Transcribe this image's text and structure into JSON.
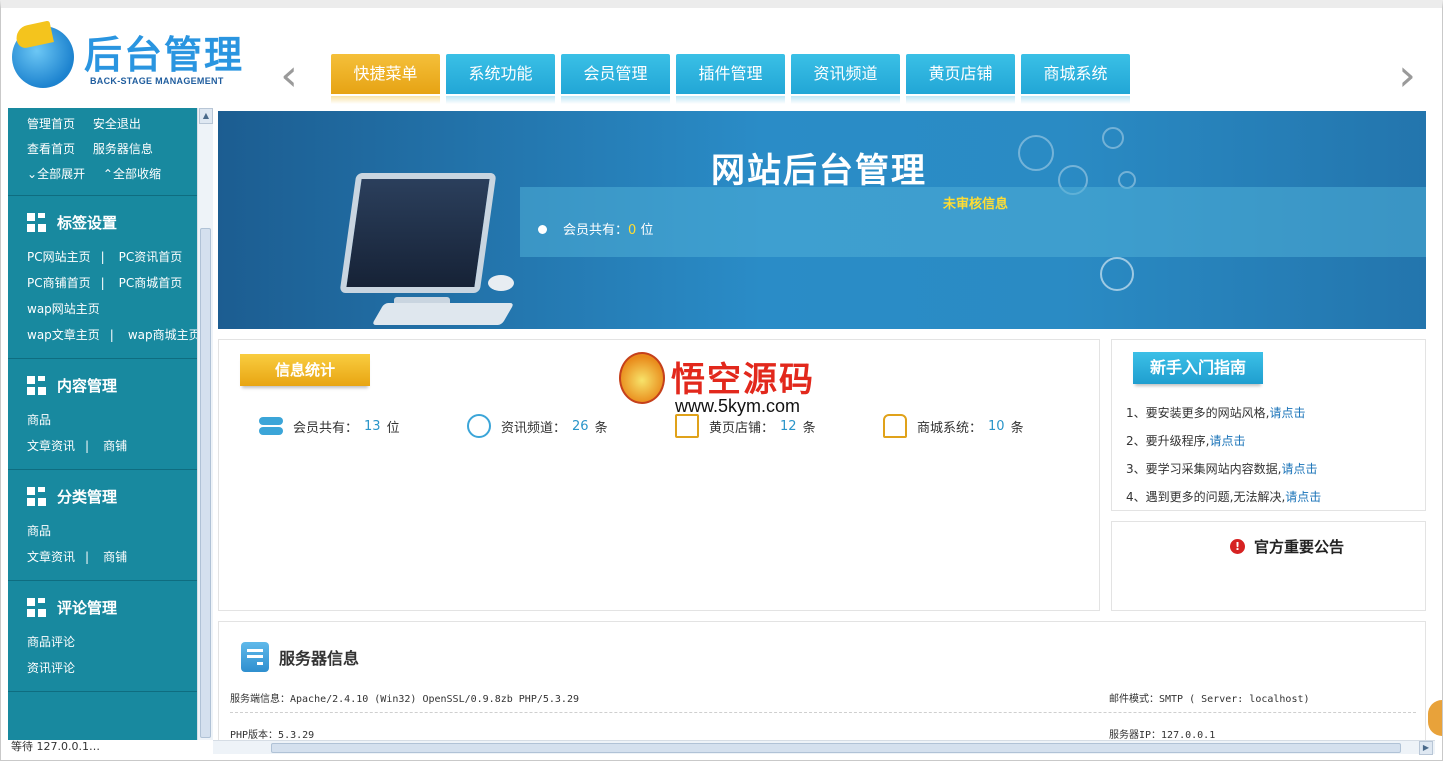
{
  "header": {
    "logo_title": "后台管理",
    "logo_subtitle": "BACK-STAGE MANAGEMENT",
    "tabs": [
      {
        "label": "快捷菜单",
        "active": true
      },
      {
        "label": "系统功能",
        "active": false
      },
      {
        "label": "会员管理",
        "active": false
      },
      {
        "label": "插件管理",
        "active": false
      },
      {
        "label": "资讯频道",
        "active": false
      },
      {
        "label": "黄页店铺",
        "active": false
      },
      {
        "label": "商城系统",
        "active": false
      }
    ]
  },
  "sidebar": {
    "top_links": [
      "管理首页",
      "安全退出",
      "查看首页",
      "服务器信息",
      "全部展开",
      "全部收缩"
    ],
    "sections": [
      {
        "title": "标签设置",
        "links": [
          "PC网站主页",
          "PC资讯首页",
          "PC商铺首页",
          "PC商城首页",
          "wap网站主页",
          "wap文章主页",
          "wap商城主页"
        ]
      },
      {
        "title": "内容管理",
        "links": [
          "商品",
          "文章资讯",
          "商铺"
        ]
      },
      {
        "title": "分类管理",
        "links": [
          "商品",
          "文章资讯",
          "商铺"
        ]
      },
      {
        "title": "评论管理",
        "links": [
          "商品评论",
          "资讯评论"
        ]
      }
    ]
  },
  "banner": {
    "title": "网站后台管理",
    "strip_title": "未审核信息",
    "member_label": "会员共有：",
    "member_count": "0",
    "member_unit": "位"
  },
  "stats": {
    "title": "信息统计",
    "items": [
      {
        "label": "会员共有：",
        "value": "13",
        "unit": "位"
      },
      {
        "label": "资讯频道：",
        "value": "26",
        "unit": "条"
      },
      {
        "label": "黄页店铺：",
        "value": "12",
        "unit": "条"
      },
      {
        "label": "商城系统：",
        "value": "10",
        "unit": "条"
      }
    ]
  },
  "watermark": {
    "text": "悟空源码",
    "url": "www.5kym.com"
  },
  "guide": {
    "title": "新手入门指南",
    "items": [
      {
        "text": "1、要安装更多的网站风格,",
        "link": "请点击"
      },
      {
        "text": "2、要升级程序,",
        "link": "请点击"
      },
      {
        "text": "3、要学习采集网站内容数据,",
        "link": "请点击"
      },
      {
        "text": "4、遇到更多的问题,无法解决,",
        "link": "请点击"
      }
    ]
  },
  "notice": {
    "title": "官方重要公告"
  },
  "server": {
    "title": "服务器信息",
    "server_info": "服务端信息：Apache/2.4.10 (Win32) OpenSSL/0.9.8zb PHP/5.3.29",
    "mail_mode": "邮件模式：SMTP ( Server: localhost)",
    "php_version": "PHP版本：5.3.29",
    "server_ip": "服务器IP：127.0.0.1"
  },
  "status_bar": {
    "text": "等待 127.0.0.1…"
  },
  "colors": {
    "sidebar": "#18899f",
    "tab": "#22a6d6",
    "tab_active": "#e6a314",
    "highlight": "#ffdd33",
    "link": "#1a73b8"
  }
}
